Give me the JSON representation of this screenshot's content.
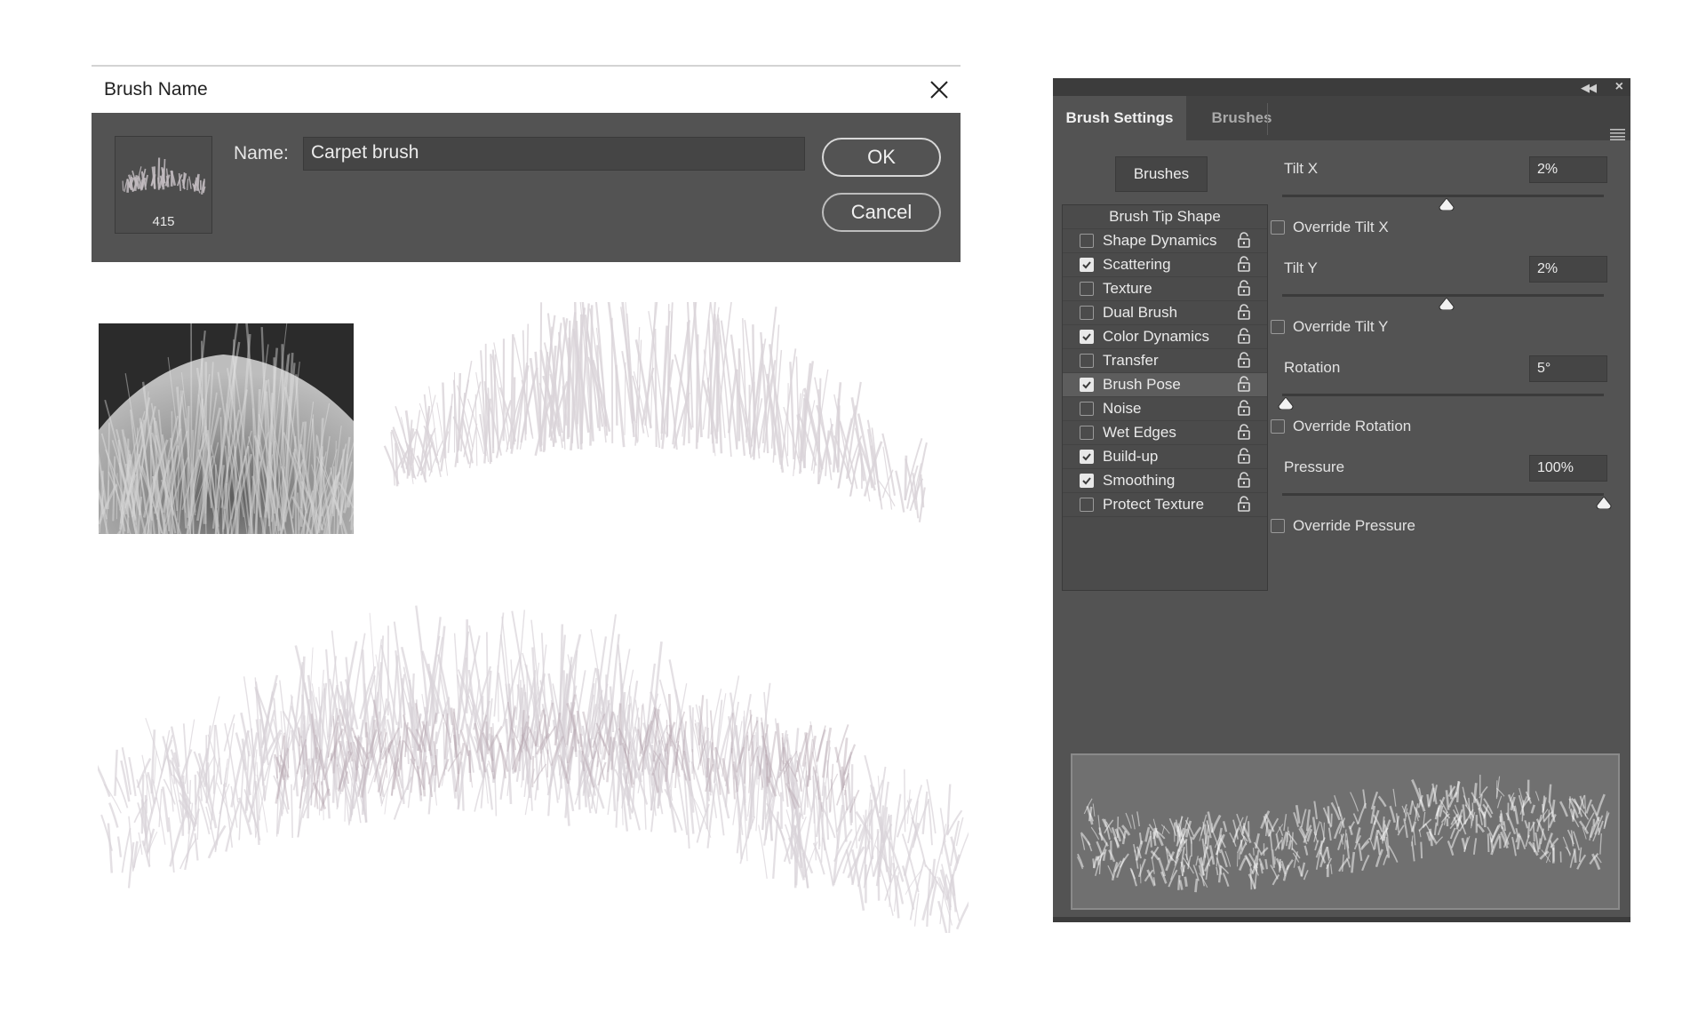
{
  "dialog": {
    "title": "Brush Name",
    "thumbnail_size": "415",
    "name_label": "Name:",
    "name_value": "Carpet brush",
    "ok_label": "OK",
    "cancel_label": "Cancel"
  },
  "panel": {
    "tabs": [
      "Brush Settings",
      "Brushes"
    ],
    "brushes_button": "Brushes",
    "list": [
      {
        "label": "Brush Tip Shape",
        "header": true
      },
      {
        "label": "Shape Dynamics",
        "checked": false
      },
      {
        "label": "Scattering",
        "checked": true
      },
      {
        "label": "Texture",
        "checked": false
      },
      {
        "label": "Dual Brush",
        "checked": false
      },
      {
        "label": "Color Dynamics",
        "checked": true
      },
      {
        "label": "Transfer",
        "checked": false
      },
      {
        "label": "Brush Pose",
        "checked": true,
        "selected": true
      },
      {
        "label": "Noise",
        "checked": false
      },
      {
        "label": "Wet Edges",
        "checked": false
      },
      {
        "label": "Build-up",
        "checked": true
      },
      {
        "label": "Smoothing",
        "checked": true
      },
      {
        "label": "Protect Texture",
        "checked": false
      }
    ],
    "tilt_x": {
      "label": "Tilt X",
      "value": "2%",
      "level": 0.51
    },
    "override_tilt_x": "Override Tilt X",
    "tilt_y": {
      "label": "Tilt Y",
      "value": "2%",
      "level": 0.51
    },
    "override_tilt_y": "Override Tilt Y",
    "rotation": {
      "label": "Rotation",
      "value": "5°",
      "level": 0.01
    },
    "override_rotation": "Override Rotation",
    "pressure": {
      "label": "Pressure",
      "value": "100%",
      "level": 1.0
    },
    "override_pressure": "Override Pressure"
  },
  "colors": {
    "panel_bg": "#535353",
    "dialog_bg": "#535353",
    "stroke_color": "#d9d3d8",
    "stroke_shadow": "#b8a9b2"
  }
}
